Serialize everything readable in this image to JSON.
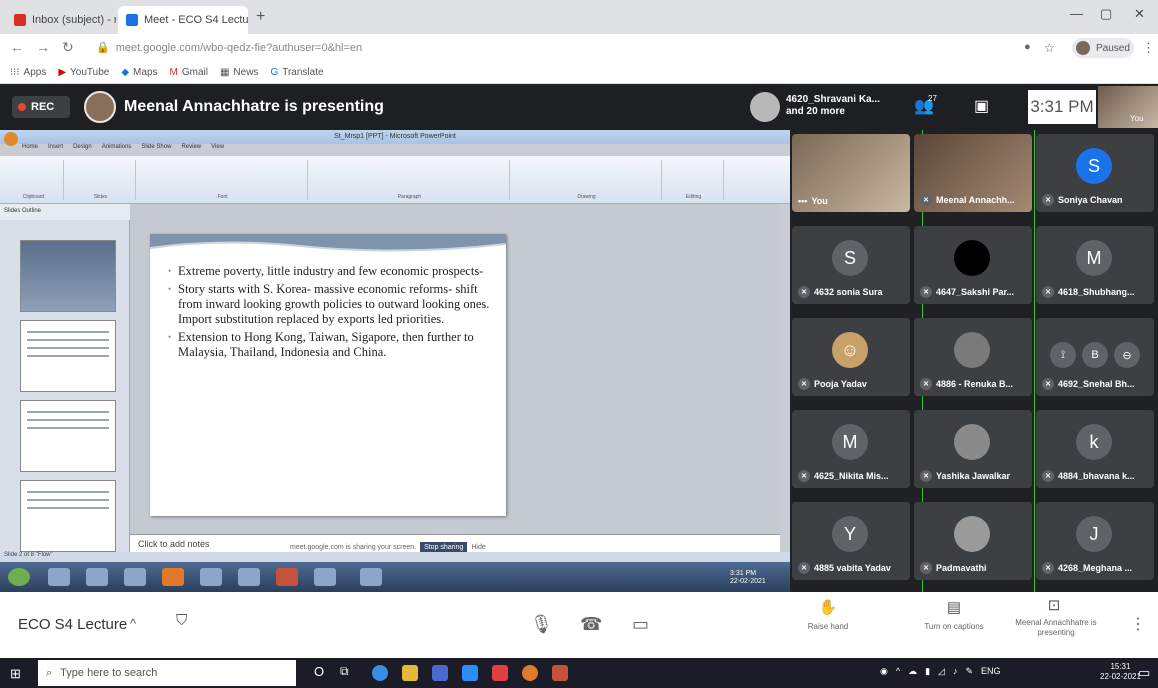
{
  "browser": {
    "tabs": [
      {
        "title": "Inbox (subject) - meenal.sunnent@m",
        "favicon_color": "#d93025"
      },
      {
        "title": "Meet - ECO S4 Lecture",
        "favicon_color": "#1a73e8"
      }
    ],
    "tab_close": "x",
    "new_tab": "+",
    "url": "meet.google.com/wbo-qedz-fie?authuser=0&hl=en",
    "profile_label": "Paused",
    "bookmarks": [
      "Apps",
      "YouTube",
      "Maps",
      "Gmail",
      "News",
      "Translate"
    ]
  },
  "meet": {
    "rec_label": "REC",
    "presenting_title": "Meenal Annachhatre is presenting",
    "participants_summary": "4620_Shravani Ka...\nand 20 more",
    "people_count": "27",
    "clock": "3:31 PM",
    "self_label": "You",
    "participants": [
      {
        "name": "You",
        "initial": "",
        "color": ""
      },
      {
        "name": "Meenal Annachh...",
        "initial": "",
        "color": ""
      },
      {
        "name": "Soniya Chavan",
        "initial": "S",
        "color": "#1a73e8"
      },
      {
        "name": "4632 sonia Sura",
        "initial": "S",
        "color": "#5f6368"
      },
      {
        "name": "4647_Sakshi Par...",
        "initial": "",
        "color": "#000000"
      },
      {
        "name": "4618_Shubhang...",
        "initial": "M",
        "color": "#5f6368"
      },
      {
        "name": "Pooja Yadav",
        "initial": "",
        "color": "#c9a06a"
      },
      {
        "name": "4886 - Renuka B...",
        "initial": "",
        "color": "#7a7a7a"
      },
      {
        "name": "4692_Snehal Bh...",
        "initial": "",
        "color": "#3c4043"
      },
      {
        "name": "4625_Nikita Mis...",
        "initial": "M",
        "color": "#5f6368"
      },
      {
        "name": "Yashika Jawalkar",
        "initial": "",
        "color": "#8a8a8a"
      },
      {
        "name": "4884_bhavana k...",
        "initial": "k",
        "color": "#5f6368"
      },
      {
        "name": "4885 vabita Yadav",
        "initial": "Y",
        "color": "#5f6368"
      },
      {
        "name": "Padmavathi",
        "initial": "",
        "color": "#9a9a9a"
      },
      {
        "name": "4268_Meghana ...",
        "initial": "J",
        "color": "#5f6368"
      }
    ],
    "tile_controls": [
      "⟟",
      "B",
      "⊖"
    ]
  },
  "presentation": {
    "app_title": "St_Mrsp1 [PPT] - Microsoft PowerPoint",
    "ribbon_tabs": [
      "Home",
      "Insert",
      "Design",
      "Animations",
      "Slide Show",
      "Review",
      "View"
    ],
    "ribbon_groups": [
      "Clipboard",
      "Slides",
      "Font",
      "Paragraph",
      "Drawing",
      "Editing"
    ],
    "outline_tabs": "Slides   Outline",
    "slide_bullets": [
      "Extreme poverty, little industry and few economic prospects-",
      "Story starts with S. Korea- massive economic reforms- shift from inward looking growth policies to outward looking ones. Import substitution replaced by exports led priorities.",
      "Extension to Hong Kong, Taiwan, Sigapore, then further to Malaysia, Thailand, Indonesia and China."
    ],
    "notes_placeholder": "Click to add notes",
    "share_text": "meet.google.com is sharing your screen.",
    "share_stop": "Stop sharing",
    "share_hide": "Hide",
    "status_text": "Slide 2 of 8   \"Flow\"",
    "win7_time": "3:31 PM\n22-02-2021"
  },
  "bottom_bar": {
    "meeting_name": "ECO S4 Lecture",
    "caret": "^",
    "raise_hand": "Raise hand",
    "captions": "Turn on captions",
    "presenting": "Meenal Annachhatre is presenting",
    "more": "⋮"
  },
  "taskbar": {
    "search_placeholder": "Type here to search",
    "lang": "ENG",
    "time": "15:31",
    "date": "22-02-2021"
  }
}
